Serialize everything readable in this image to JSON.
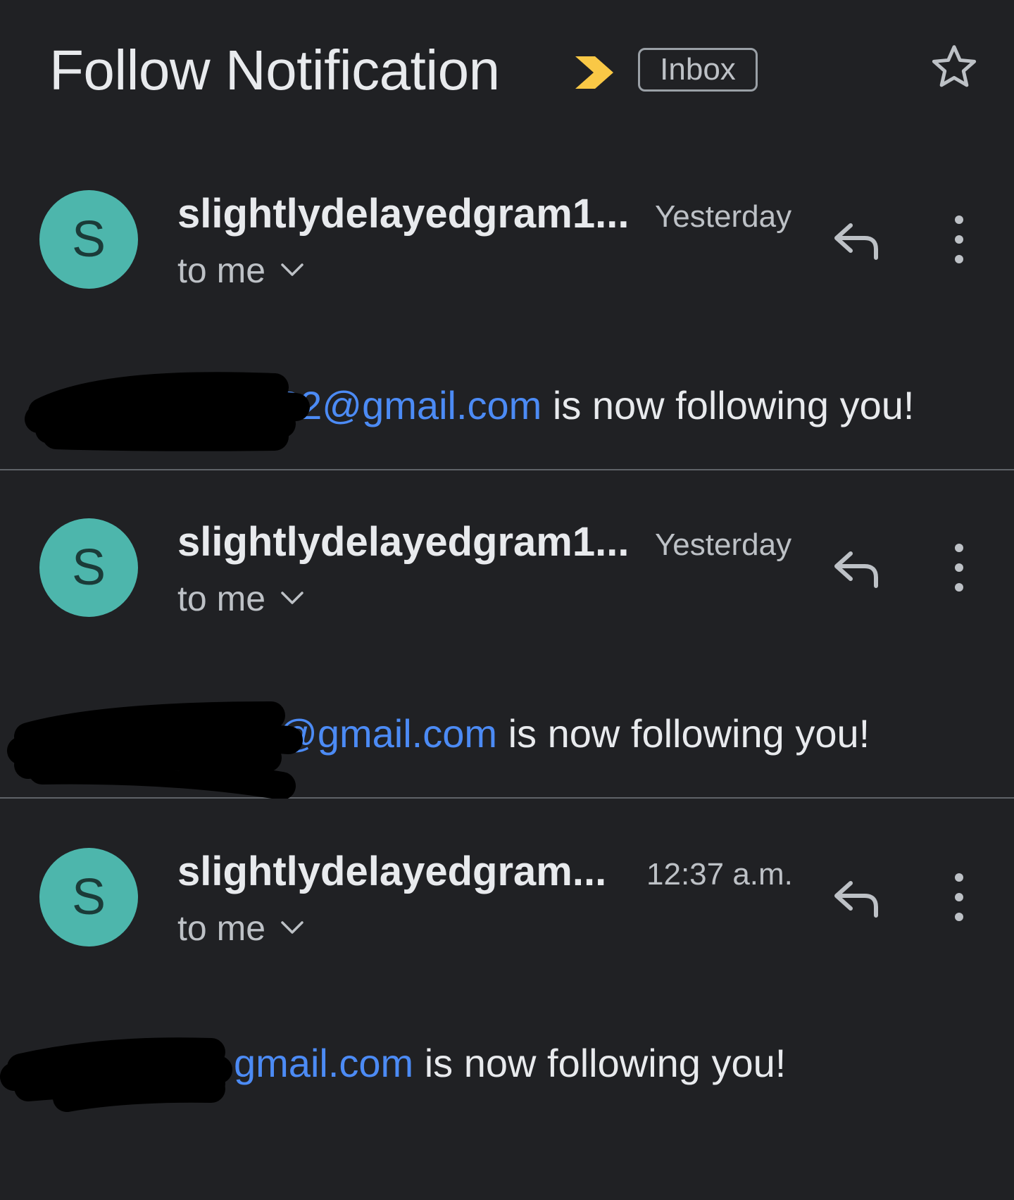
{
  "thread": {
    "subject": "Follow Notification",
    "label": "Inbox",
    "importance_marker": "importance-chevron-icon",
    "starred": false,
    "colors": {
      "background": "#202124",
      "primary_text": "#e8eaed",
      "secondary_text": "#bdc1c6",
      "link": "#4c8bf5",
      "importance": "#f9c846",
      "avatar": "#4db6ac"
    }
  },
  "messages": [
    {
      "avatar_letter": "S",
      "sender": "slightlydelayedgram1...",
      "time": "Yesterday",
      "recipient": "to me",
      "email_visible": "22@gmail.com",
      "body_suffix": " is now following you!"
    },
    {
      "avatar_letter": "S",
      "sender": "slightlydelayedgram1...",
      "time": "Yesterday",
      "recipient": "to me",
      "email_visible": "@gmail.com",
      "body_suffix": " is now following you!"
    },
    {
      "avatar_letter": "S",
      "sender": "slightlydelayedgram...",
      "time": "12:37 a.m.",
      "recipient": "to me",
      "email_visible": "gmail.com",
      "body_suffix": " is now following you!"
    }
  ]
}
